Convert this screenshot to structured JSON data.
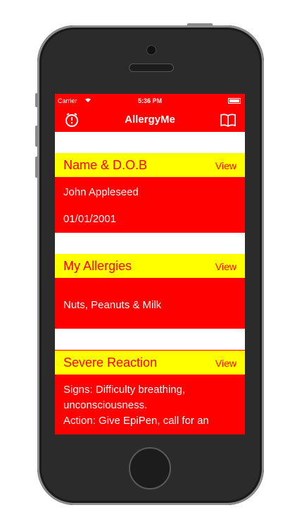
{
  "status_bar": {
    "carrier": "Carrier",
    "time": "5:36 PM"
  },
  "nav": {
    "title": "AllergyMe",
    "left_icon": "alarm-clock-icon",
    "right_icon": "book-icon"
  },
  "sections": [
    {
      "title": "Name & D.O.B",
      "action": "View",
      "lines": [
        "John Appleseed",
        "01/01/2001"
      ]
    },
    {
      "title": "My Allergies",
      "action": "View",
      "lines": [
        "Nuts, Peanuts & Milk"
      ]
    },
    {
      "title": "Severe Reaction",
      "action": "View",
      "lines": [
        "Signs: Difficulty breathing,",
        "unconsciousness.",
        "Action: Give EpiPen, call for an"
      ]
    }
  ],
  "colors": {
    "primary": "#ff0000",
    "header_band": "#ffff00",
    "separator": "#ffffff"
  }
}
